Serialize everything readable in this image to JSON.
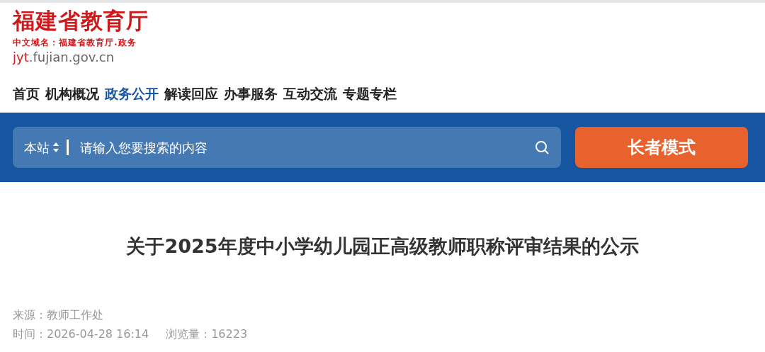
{
  "logo": {
    "title": "福建省教育厅",
    "subtitle": "中文域名：福建省教育厅.政务",
    "domain_prefix": "jyt",
    "domain_rest": ".fujian.gov.cn"
  },
  "nav": [
    {
      "label": "首页",
      "selected": false
    },
    {
      "label": "机构概况",
      "selected": false
    },
    {
      "label": "政务公开",
      "selected": true
    },
    {
      "label": "解读回应",
      "selected": false
    },
    {
      "label": "办事服务",
      "selected": false
    },
    {
      "label": "互动交流",
      "selected": false
    },
    {
      "label": "专题专栏",
      "selected": false
    }
  ],
  "search": {
    "scope": "本站",
    "placeholder": "请输入您要搜索的内容"
  },
  "elder_button": "长者模式",
  "article": {
    "title": "关于2025年度中小学幼儿园正高级教师职称评审结果的公示",
    "source": "来源：教师工作处",
    "time": "时间：2026-04-28 16:14",
    "views": "浏览量：16223"
  }
}
